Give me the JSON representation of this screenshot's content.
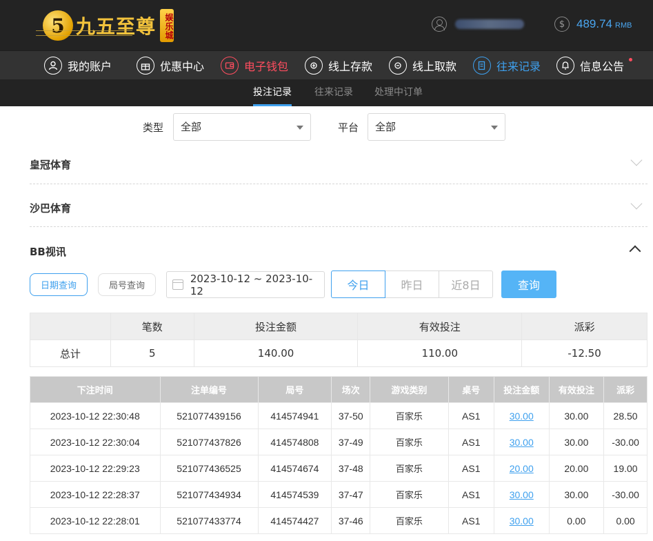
{
  "brand": {
    "logo_mark": "5",
    "name": "九五至尊",
    "badge": "娱乐城"
  },
  "account": {
    "balance": "489.74",
    "currency": "RMB"
  },
  "nav": {
    "items": [
      {
        "label": "我的账户",
        "icon": "user-circle-icon"
      },
      {
        "label": "优惠中心",
        "icon": "gift-icon"
      },
      {
        "label": "电子钱包",
        "icon": "wallet-icon"
      },
      {
        "label": "线上存款",
        "icon": "deposit-icon"
      },
      {
        "label": "线上取款",
        "icon": "withdraw-icon"
      },
      {
        "label": "往来记录",
        "icon": "records-icon"
      },
      {
        "label": "信息公告",
        "icon": "bell-icon"
      }
    ],
    "active_label": "往来记录",
    "highlight_label": "电子钱包"
  },
  "subnav": {
    "tabs": [
      "投注记录",
      "往来记录",
      "处理中订单"
    ],
    "active": "投注记录"
  },
  "filters": {
    "type_label": "类型",
    "type_value": "全部",
    "platform_label": "平台",
    "platform_value": "全部"
  },
  "sections": [
    "皇冠体育",
    "沙巴体育",
    "BB视讯"
  ],
  "query": {
    "date_query": "日期查询",
    "round_query": "局号查询",
    "date_range": "2023-10-12 ~ 2023-10-12",
    "quick_ranges": [
      "今日",
      "昨日",
      "近8日"
    ],
    "active_range": "今日",
    "search_label": "查询"
  },
  "summary": {
    "headers": [
      "",
      "笔数",
      "投注金额",
      "有效投注",
      "派彩"
    ],
    "row": {
      "label": "总计",
      "count": "5",
      "bet": "140.00",
      "valid": "110.00",
      "payout": "-12.50"
    }
  },
  "bets": {
    "headers": [
      "下注时间",
      "注单编号",
      "局号",
      "场次",
      "游戏类别",
      "桌号",
      "投注金额",
      "有效投注",
      "派彩"
    ],
    "rows": [
      {
        "time": "2023-10-12 22:30:48",
        "id": "521077439156",
        "round": "414574941",
        "match": "37-50",
        "game": "百家乐",
        "table": "AS1",
        "bet": "30.00",
        "valid": "30.00",
        "payout": "28.50",
        "negative": false
      },
      {
        "time": "2023-10-12 22:30:04",
        "id": "521077437826",
        "round": "414574808",
        "match": "37-49",
        "game": "百家乐",
        "table": "AS1",
        "bet": "30.00",
        "valid": "30.00",
        "payout": "-30.00",
        "negative": true
      },
      {
        "time": "2023-10-12 22:29:23",
        "id": "521077436525",
        "round": "414574674",
        "match": "37-48",
        "game": "百家乐",
        "table": "AS1",
        "bet": "20.00",
        "valid": "20.00",
        "payout": "19.00",
        "negative": false
      },
      {
        "time": "2023-10-12 22:28:37",
        "id": "521077434934",
        "round": "414574539",
        "match": "37-47",
        "game": "百家乐",
        "table": "AS1",
        "bet": "30.00",
        "valid": "30.00",
        "payout": "-30.00",
        "negative": true
      },
      {
        "time": "2023-10-12 22:28:01",
        "id": "521077433774",
        "round": "414574427",
        "match": "37-46",
        "game": "百家乐",
        "table": "AS1",
        "bet": "30.00",
        "valid": "0.00",
        "payout": "0.00",
        "negative": false
      }
    ]
  },
  "colors": {
    "accent": "#3ea0ee",
    "highlight": "#ff4d5f",
    "negative": "#e0403e",
    "brand_gold": "#f3c33c"
  }
}
